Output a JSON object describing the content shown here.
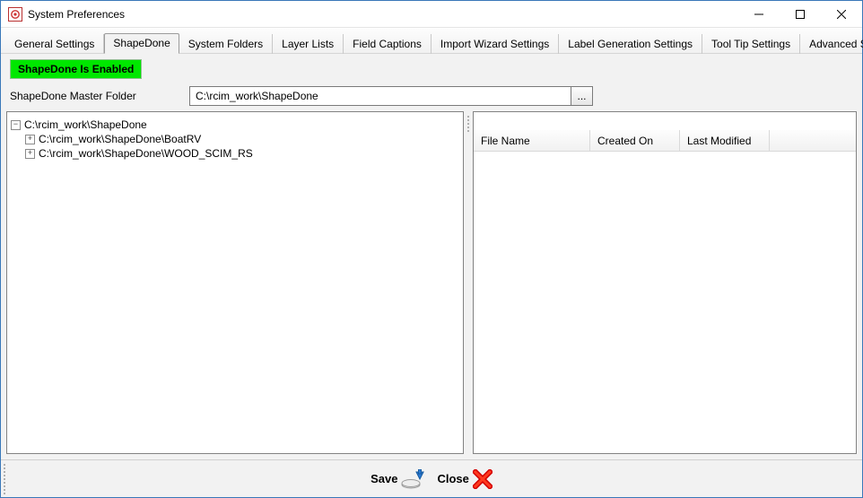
{
  "window": {
    "title": "System Preferences"
  },
  "tabs": [
    {
      "label": "General Settings"
    },
    {
      "label": "ShapeDone"
    },
    {
      "label": "System Folders"
    },
    {
      "label": "Layer Lists"
    },
    {
      "label": "Field Captions"
    },
    {
      "label": "Import Wizard Settings"
    },
    {
      "label": "Label Generation Settings"
    },
    {
      "label": "Tool Tip Settings"
    },
    {
      "label": "Advanced Settings"
    }
  ],
  "active_tab_index": 1,
  "status_text": "ShapeDone Is Enabled",
  "master_folder": {
    "label": "ShapeDone Master Folder",
    "value": "C:\\rcim_work\\ShapeDone",
    "browse_label": "..."
  },
  "tree": {
    "root": {
      "label": "C:\\rcim_work\\ShapeDone",
      "expanded": true,
      "children": [
        {
          "label": "C:\\rcim_work\\ShapeDone\\BoatRV",
          "expanded": false
        },
        {
          "label": "C:\\rcim_work\\ShapeDone\\WOOD_SCIM_RS",
          "expanded": false
        }
      ]
    }
  },
  "grid": {
    "columns": [
      "File Name",
      "Created On",
      "Last Modified"
    ],
    "rows": []
  },
  "buttons": {
    "save": "Save",
    "close": "Close"
  },
  "icons": {
    "minus": "−",
    "plus": "+"
  }
}
